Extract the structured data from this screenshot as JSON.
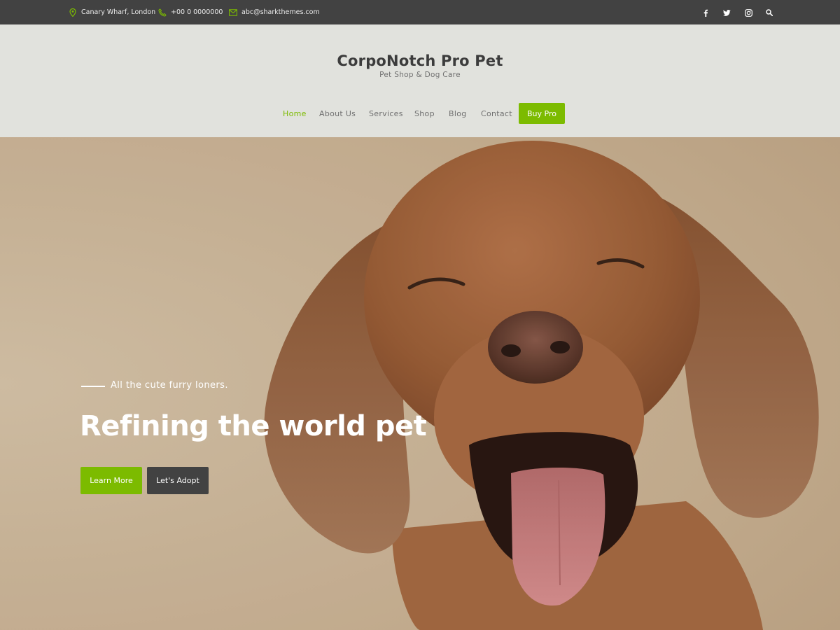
{
  "topbar": {
    "address": "Canary Wharf, London",
    "phone": "+00 0 0000000",
    "email": "abc@sharkthemes.com",
    "icons": [
      "map-pin-icon",
      "phone-icon",
      "envelope-icon"
    ],
    "social_icons": [
      "facebook-icon",
      "twitter-icon",
      "instagram-icon",
      "search-icon"
    ]
  },
  "header": {
    "title": "CorpoNotch Pro Pet",
    "tagline": "Pet Shop & Dog Care"
  },
  "nav": {
    "items": [
      "Home",
      "About Us",
      "Services",
      "Shop",
      "Blog",
      "Contact"
    ],
    "active": "Home",
    "buy_label": "Buy Pro"
  },
  "hero": {
    "subtitle": "All the cute furry loners.",
    "title": "Refining the world pet",
    "primary_button": "Learn More",
    "secondary_button": "Let's Adopt"
  },
  "colors": {
    "accent": "#7cbb00",
    "topbar": "#424242",
    "header_bg": "#e1e2dd",
    "dark_button": "#424242"
  }
}
